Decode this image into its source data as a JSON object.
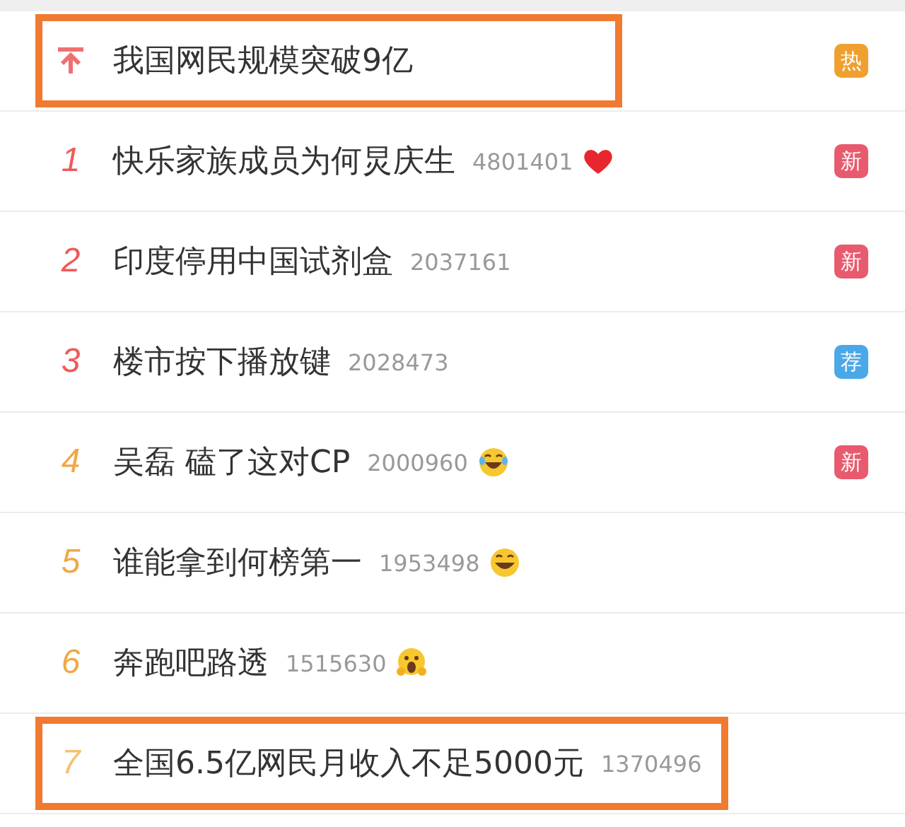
{
  "hot_list": [
    {
      "rank": {
        "kind": "pinned",
        "color": "#f07070"
      },
      "title": "我国网民规模突破9亿",
      "highlighted": true,
      "badge": {
        "text": "热",
        "color": "#f0a030"
      }
    },
    {
      "rank": {
        "kind": "number",
        "text": "1",
        "color": "#f05a5a"
      },
      "title": "快乐家族成员为何炅庆生",
      "count": "4801401",
      "emoji": {
        "kind": "heart"
      },
      "highlighted": false,
      "badge": {
        "text": "新",
        "color": "#e85a6e"
      }
    },
    {
      "rank": {
        "kind": "number",
        "text": "2",
        "color": "#f05a5a"
      },
      "title": "印度停用中国试剂盒",
      "count": "2037161",
      "highlighted": false,
      "badge": {
        "text": "新",
        "color": "#e85a6e"
      }
    },
    {
      "rank": {
        "kind": "number",
        "text": "3",
        "color": "#f05a5a"
      },
      "title": "楼市按下播放键",
      "count": "2028473",
      "highlighted": false,
      "badge": {
        "text": "荐",
        "color": "#4aa8e8"
      }
    },
    {
      "rank": {
        "kind": "number",
        "text": "4",
        "color": "#f0a845"
      },
      "title": "吴磊 磕了这对CP",
      "count": "2000960",
      "emoji": {
        "kind": "laugh-cry"
      },
      "highlighted": false,
      "badge": {
        "text": "新",
        "color": "#e85a6e"
      }
    },
    {
      "rank": {
        "kind": "number",
        "text": "5",
        "color": "#f0a845"
      },
      "title": "谁能拿到何榜第一",
      "count": "1953498",
      "emoji": {
        "kind": "laugh"
      },
      "highlighted": false
    },
    {
      "rank": {
        "kind": "number",
        "text": "6",
        "color": "#f0a845"
      },
      "title": "奔跑吧路透",
      "count": "1515630",
      "emoji": {
        "kind": "shock"
      },
      "highlighted": false
    },
    {
      "rank": {
        "kind": "number",
        "text": "7",
        "color": "#f5c070"
      },
      "title": "全国6.5亿网民月收入不足5000元",
      "count": "1370496",
      "highlighted": true
    }
  ]
}
